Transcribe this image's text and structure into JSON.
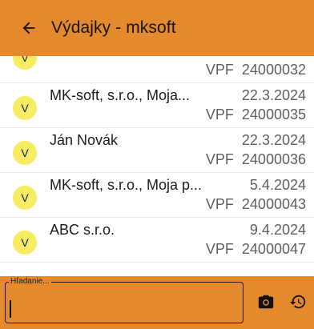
{
  "header": {
    "title": "Výdajky - mksoft"
  },
  "list": {
    "items": [
      {
        "avatar": "V",
        "name": "",
        "date": "",
        "doc_type": "VPF",
        "doc_number": "24000032"
      },
      {
        "avatar": "V",
        "name": "MK-soft, s.r.o., Moja...",
        "date": "22.3.2024",
        "doc_type": "VPF",
        "doc_number": "24000035"
      },
      {
        "avatar": "V",
        "name": "Ján Novák",
        "date": "22.3.2024",
        "doc_type": "VPF",
        "doc_number": "24000036"
      },
      {
        "avatar": "V",
        "name": "MK-soft, s.r.o., Moja p...",
        "date": "5.4.2024",
        "doc_type": "VPF",
        "doc_number": "24000043"
      },
      {
        "avatar": "V",
        "name": "ABC s.r.o.",
        "date": "9.4.2024",
        "doc_type": "VPF",
        "doc_number": "24000047"
      }
    ]
  },
  "search": {
    "label": "Hľadanie...",
    "value": ""
  },
  "icons": {
    "back": "arrow-left-icon",
    "camera": "camera-icon",
    "history": "history-icon"
  },
  "colors": {
    "accent": "#e48a2c",
    "avatar": "#f8ec63"
  }
}
